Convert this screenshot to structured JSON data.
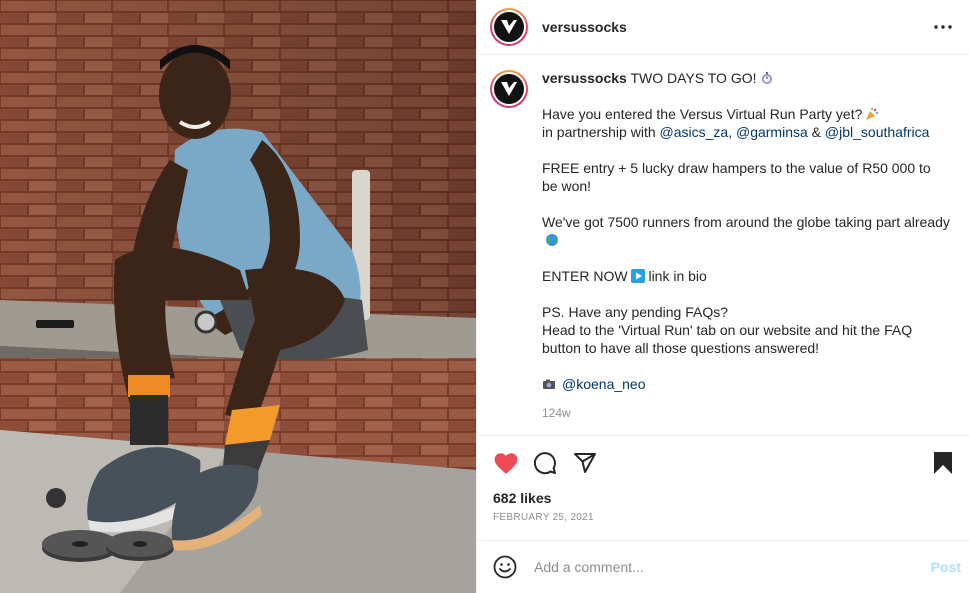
{
  "account": {
    "username": "versussocks",
    "logo_letter": "V"
  },
  "photo": {
    "description_icon": "photo-of-runner-icon"
  },
  "caption": {
    "username": "versussocks",
    "line1": "TWO DAYS TO GO!",
    "line2": "Have you entered the Versus Virtual Run Party yet?",
    "line3_prefix": "in partnership with",
    "mention_1": "@asics_za",
    "comma": ",",
    "mention_2": "@garminsa",
    "ampersand": "&",
    "mention_3": "@jbl_southafrica",
    "line4": "FREE entry + 5 lucky draw hampers to the value of R50 000 to be won!",
    "line5": "We've got 7500 runners from around the globe taking part already",
    "line6_prefix": "ENTER NOW",
    "line6_suffix": "link in bio",
    "line7": "PS. Have any pending FAQs?",
    "line8": "Head to the 'Virtual Run' tab on our website and hit the FAQ button to have all those questions answered!",
    "photo_credit": "@koena_neo",
    "time_ago": "124w"
  },
  "actions": {
    "likes": "682 likes",
    "date": "FEBRUARY 25, 2021",
    "like_color": "#ed4956"
  },
  "comment_box": {
    "placeholder": "Add a comment...",
    "post_label": "Post"
  }
}
